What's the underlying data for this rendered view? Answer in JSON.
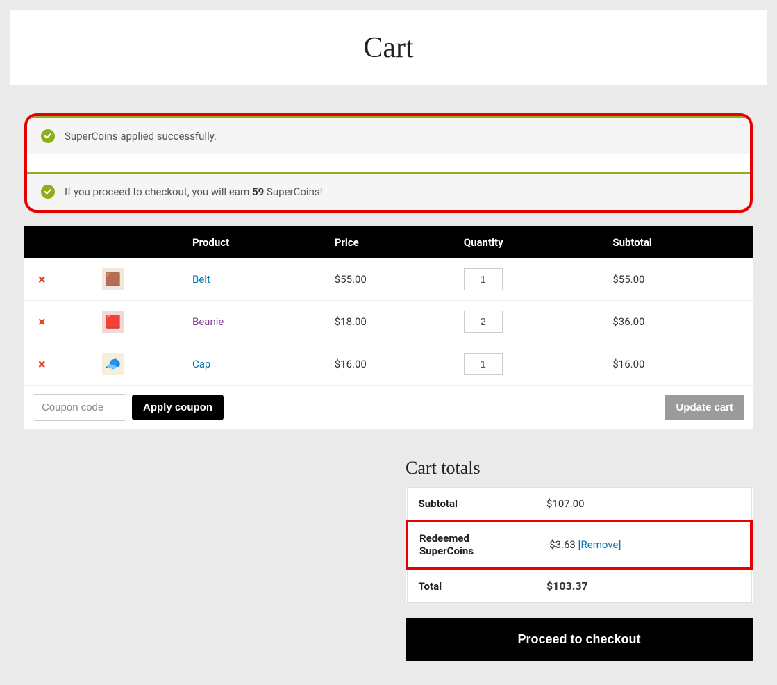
{
  "page": {
    "title": "Cart"
  },
  "notices": {
    "applied": "SuperCoins applied successfully.",
    "earn_prefix": "If you proceed to checkout, you will earn ",
    "earn_amount": "59",
    "earn_suffix": " SuperCoins!"
  },
  "table": {
    "headers": {
      "product": "Product",
      "price": "Price",
      "quantity": "Quantity",
      "subtotal": "Subtotal"
    },
    "rows": [
      {
        "name": "Belt",
        "link_class": "",
        "thumb_glyph": "🟫",
        "thumb_bg": "#f1e6dc",
        "price": "$55.00",
        "qty": "1",
        "subtotal": "$55.00"
      },
      {
        "name": "Beanie",
        "link_class": "visited",
        "thumb_glyph": "🟥",
        "thumb_bg": "#f3d8d8",
        "price": "$18.00",
        "qty": "2",
        "subtotal": "$36.00"
      },
      {
        "name": "Cap",
        "link_class": "",
        "thumb_glyph": "🧢",
        "thumb_bg": "#f4efda",
        "price": "$16.00",
        "qty": "1",
        "subtotal": "$16.00"
      }
    ],
    "coupon_placeholder": "Coupon code",
    "apply_coupon": "Apply coupon",
    "update_cart": "Update cart"
  },
  "totals": {
    "title": "Cart totals",
    "subtotal_label": "Subtotal",
    "subtotal_value": "$107.00",
    "redeemed_label": "Redeemed SuperCoins",
    "redeemed_value": "-$3.63",
    "remove_label": "[Remove]",
    "total_label": "Total",
    "total_value": "$103.37",
    "checkout": "Proceed to checkout"
  }
}
